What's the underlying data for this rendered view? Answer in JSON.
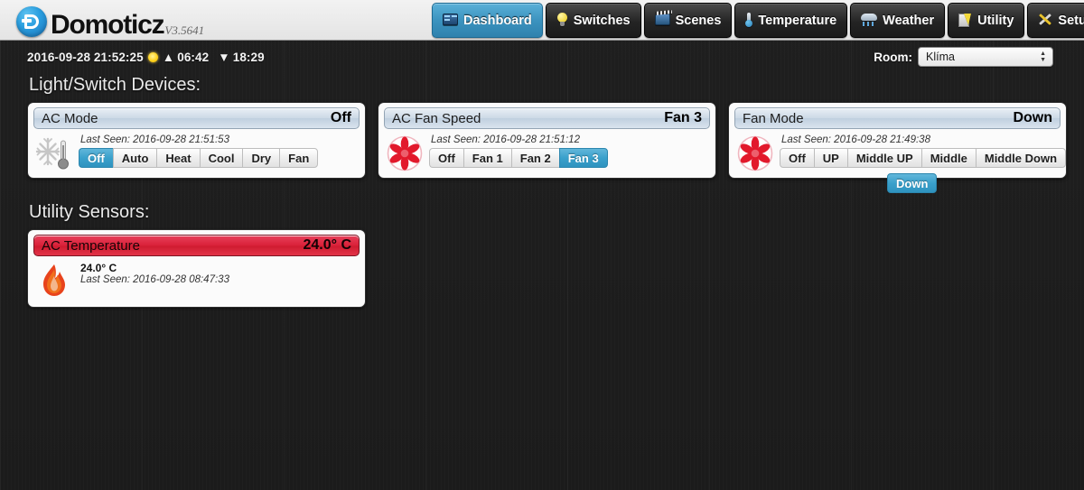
{
  "brand": {
    "name": "Domoticz",
    "version": "V3.5641",
    "logo_icon": "domoticz-logo-icon"
  },
  "nav": [
    {
      "label": "Dashboard",
      "icon": "dashboard-icon",
      "active": true
    },
    {
      "label": "Switches",
      "icon": "lightbulb-icon",
      "active": false
    },
    {
      "label": "Scenes",
      "icon": "clapperboard-icon",
      "active": false
    },
    {
      "label": "Temperature",
      "icon": "thermometer-icon",
      "active": false
    },
    {
      "label": "Weather",
      "icon": "cloud-rain-icon",
      "active": false
    },
    {
      "label": "Utility",
      "icon": "utility-meter-icon",
      "active": false
    },
    {
      "label": "Setup",
      "icon": "tools-icon",
      "active": false,
      "has_caret": true
    }
  ],
  "infobar": {
    "datetime": "2016-09-28 21:52:25",
    "sun_icon": "sun-icon",
    "sunrise_arrow": "▲",
    "sunrise": "06:42",
    "sunset_arrow": "▼",
    "sunset": "18:29",
    "room_label": "Room:",
    "room_selected": "Klíma"
  },
  "sections": {
    "lights_title": "Light/Switch Devices:",
    "utility_title": "Utility Sensors:"
  },
  "devices": [
    {
      "name": "AC Mode",
      "status": "Off",
      "icon": "snowflake-thermometer-icon",
      "last_seen": "Last Seen: 2016-09-28 21:51:53",
      "last_seen_label": "Last Seen:",
      "buttons": [
        {
          "label": "Off",
          "selected": true
        },
        {
          "label": "Auto",
          "selected": false
        },
        {
          "label": "Heat",
          "selected": false
        },
        {
          "label": "Cool",
          "selected": false
        },
        {
          "label": "Dry",
          "selected": false
        },
        {
          "label": "Fan",
          "selected": false
        }
      ]
    },
    {
      "name": "AC Fan Speed",
      "status": "Fan 3",
      "icon": "fan-icon",
      "last_seen": "Last Seen: 2016-09-28 21:51:12",
      "buttons": [
        {
          "label": "Off",
          "selected": false
        },
        {
          "label": "Fan 1",
          "selected": false
        },
        {
          "label": "Fan 2",
          "selected": false
        },
        {
          "label": "Fan 3",
          "selected": true
        }
      ]
    },
    {
      "name": "Fan Mode",
      "status": "Down",
      "icon": "fan-icon",
      "last_seen": "Last Seen: 2016-09-28 21:49:38",
      "buttons": [
        {
          "label": "Off",
          "selected": false
        },
        {
          "label": "UP",
          "selected": false
        },
        {
          "label": "Middle UP",
          "selected": false
        },
        {
          "label": "Middle",
          "selected": false
        },
        {
          "label": "Middle Down",
          "selected": false
        },
        {
          "label": "Down",
          "selected": true,
          "wrapped": true
        }
      ]
    }
  ],
  "utility": [
    {
      "name": "AC Temperature",
      "status": "24.0° C",
      "icon": "flame-icon",
      "value": "24.0° C",
      "last_seen": "Last Seen: 2016-09-28 08:47:33"
    }
  ],
  "colors": {
    "accent_blue": "#39a0cb",
    "nav_active": "#3b92be",
    "alert_red": "#d92038",
    "page_bg": "#1d1d1d",
    "panel_bg": "#fbfbfb"
  }
}
